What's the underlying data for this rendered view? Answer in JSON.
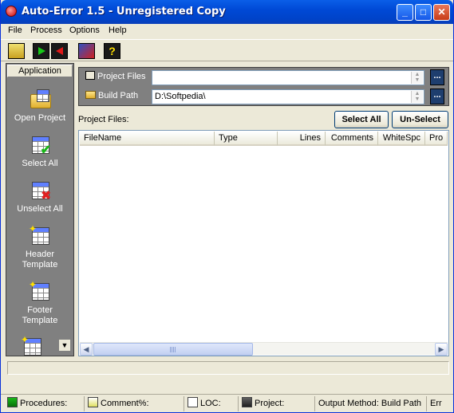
{
  "window": {
    "title": "Auto-Error 1.5 - Unregistered Copy",
    "min": "_",
    "max": "□",
    "close": "✕"
  },
  "menu": [
    "File",
    "Process",
    "Options",
    "Help"
  ],
  "toolbar": {
    "help_glyph": "?"
  },
  "sidebar": {
    "header": "Application",
    "items": [
      {
        "label": "Open Project"
      },
      {
        "label": "Select All"
      },
      {
        "label": "Unselect All"
      },
      {
        "label": "Header Template"
      },
      {
        "label": "Footer Template"
      }
    ],
    "scroll_glyph": "▼"
  },
  "paths": {
    "project_files_label": "Project Files",
    "project_files_value": "",
    "build_path_label": "Build Path",
    "build_path_value": "D:\\Softpedia\\",
    "browse": "..."
  },
  "project_files_label": "Project Files:",
  "buttons": {
    "select_all": "Select All",
    "unselect": "Un-Select"
  },
  "columns": [
    "FileName",
    "Type",
    "Lines",
    "Comments",
    "WhiteSpc",
    "Pro"
  ],
  "scroll": {
    "left": "◀",
    "right": "▶"
  },
  "status": {
    "procedures": "Procedures:",
    "comment_pct": "Comment%:",
    "loc": "LOC:",
    "project": "Project:",
    "output_method": "Output Method: Build Path",
    "tail": "Err"
  }
}
